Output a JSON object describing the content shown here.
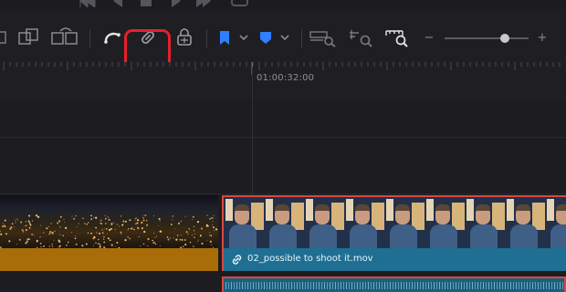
{
  "transport": {
    "buttons": [
      "skip-to-start-icon",
      "play-reverse-icon",
      "stop-icon",
      "play-icon",
      "skip-to-end-icon",
      "loop-icon"
    ]
  },
  "toolbar": {
    "tools": [
      {
        "name": "replace-clip-icon"
      },
      {
        "name": "overwrite-clip-icon"
      },
      {
        "name": "ripple-overwrite-icon"
      },
      {
        "name": "snapping-icon"
      },
      {
        "name": "linked-selection-icon",
        "highlighted": true
      },
      {
        "name": "position-lock-icon"
      },
      {
        "name": "flag-icon",
        "color": "#2f7fff"
      },
      {
        "name": "marker-icon",
        "color": "#2f7fff"
      },
      {
        "name": "full-extent-zoom-icon"
      },
      {
        "name": "detail-zoom-icon"
      },
      {
        "name": "custom-zoom-icon"
      }
    ],
    "zoom_minus": "−",
    "zoom_plus": "+",
    "zoom_level": 0.72
  },
  "ruler": {
    "timecode": "01:00:32:00"
  },
  "clips": {
    "video_clip_name": "02_possible to shoot it.mov",
    "left_clip_color": "#a86d08",
    "right_clip_color": "#1f6f93",
    "selected_border": "#d9483c"
  },
  "accent_highlight": "#e5202b"
}
